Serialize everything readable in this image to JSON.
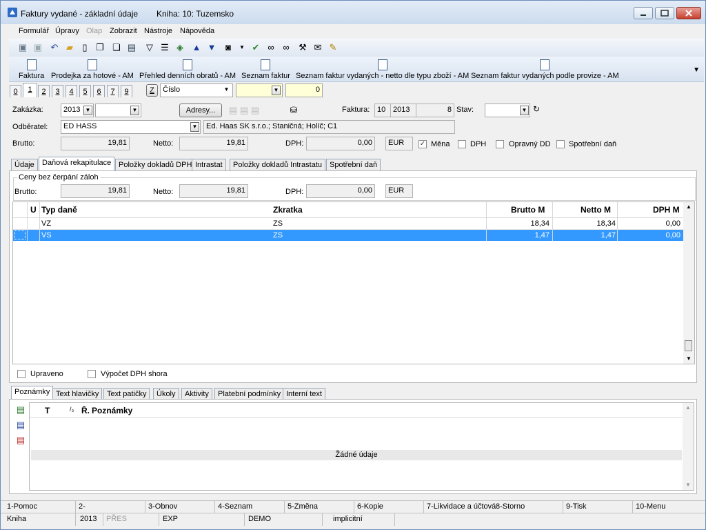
{
  "window": {
    "title": "Faktury vydané - základní údaje",
    "subtitle": "Kniha: 10: Tuzemsko"
  },
  "menu": {
    "items": [
      {
        "label": "Formulář",
        "disabled": false
      },
      {
        "label": "Úpravy",
        "disabled": false
      },
      {
        "label": "Olap",
        "disabled": true
      },
      {
        "label": "Zobrazit",
        "disabled": false
      },
      {
        "label": "Nástroje",
        "disabled": false
      },
      {
        "label": "Nápověda",
        "disabled": false
      }
    ]
  },
  "toolbar": {
    "icons": [
      "save-icon",
      "save-disabled-icon",
      "undo-icon",
      "open-folder-icon",
      "new-document-icon",
      "copy-icon",
      "paste-icon",
      "book-icon",
      "filter-icon",
      "filter-list-icon",
      "stack-icon",
      "arrow-up-icon",
      "arrow-down-icon",
      "camera-icon",
      "dropdown-icon",
      "run-icon",
      "binoculars-icon",
      "binoculars-next-icon",
      "tools-icon",
      "mail-icon",
      "notes-icon"
    ]
  },
  "ribbon": {
    "buttons": [
      {
        "label": "Faktura"
      },
      {
        "label": "Prodejka za hotové - AM"
      },
      {
        "label": "Přehled denních obratů - AM"
      },
      {
        "label": "Seznam faktur"
      },
      {
        "label": "Seznam faktur vydaných - netto dle typu zboží - AM"
      },
      {
        "label": "Seznam faktur vydaných podle provize - AM"
      }
    ]
  },
  "pagetabs": {
    "labels": [
      "0",
      "1",
      "2",
      "3",
      "4",
      "5",
      "6",
      "7",
      "9"
    ],
    "active": "1"
  },
  "filter": {
    "z_label": "Z",
    "field": "Číslo",
    "value": "",
    "count": "0"
  },
  "form": {
    "zakazka_label": "Zakázka:",
    "zakazka_year": "2013",
    "zakazka_value": "",
    "adresy_label": "Adresy...",
    "faktura_label": "Faktura:",
    "faktura_book": "10",
    "faktura_year": "2013",
    "faktura_number": "8",
    "stav_label": "Stav:",
    "stav_value": "",
    "odberatel_label": "Odběratel:",
    "odberatel_value": "ED HASS",
    "odberatel_address": "Ed. Haas SK s.r.o.; Staničná; Holíč; C1",
    "brutto_label": "Brutto:",
    "brutto_value": "19,81",
    "netto_label": "Netto:",
    "netto_value": "19,81",
    "dph_label": "DPH:",
    "dph_value": "0,00",
    "currency": "EUR",
    "mena_label": "Měna",
    "mena_checked": true,
    "dph_check_label": "DPH",
    "opravny_label": "Opravný DD",
    "spotrebni_label": "Spotřební daň"
  },
  "maintabs": {
    "labels": [
      "Údaje",
      "Daňová rekapitulace",
      "Položky dokladů DPH",
      "Intrastat",
      "Položky dokladů Intrastatu",
      "Spotřební daň"
    ],
    "active": "Daňová rekapitulace"
  },
  "recap": {
    "group_label": "Ceny bez čerpání záloh",
    "brutto_label": "Brutto:",
    "brutto_value": "19,81",
    "netto_label": "Netto:",
    "netto_value": "19,81",
    "dph_label": "DPH:",
    "dph_value": "0,00",
    "currency": "EUR"
  },
  "grid": {
    "headers": [
      "U",
      "Typ daně",
      "Zkratka",
      "Brutto M",
      "Netto M",
      "DPH M"
    ],
    "rows": [
      {
        "typ": "VZ",
        "zkratka": "ZS",
        "brutto": "18,34",
        "netto": "18,34",
        "dph": "0,00",
        "selected": false
      },
      {
        "typ": "VS",
        "zkratka": "ZS",
        "brutto": "1,47",
        "netto": "1,47",
        "dph": "0,00",
        "selected": true
      }
    ],
    "selection_color": "#3399ff"
  },
  "options": {
    "upraveno_label": "Upraveno",
    "vypocet_label": "Výpočet DPH shora"
  },
  "bottomtabs": {
    "labels": [
      "Poznámky",
      "Text hlavičky",
      "Text patičky",
      "Úkoly",
      "Aktivity",
      "Platební podmínky",
      "Interní text"
    ],
    "active": "Poznámky"
  },
  "notes": {
    "col_t": "T",
    "col_sort": "/₃",
    "col_r": "Ř.",
    "col_title": "Poznámky",
    "empty": "Žádné údaje"
  },
  "fkeys": [
    "1-Pomoc",
    "2-",
    "3-Obnov",
    "4-Seznam",
    "5-Změna",
    "6-Kopie",
    "7-Likvidace a účtová",
    "8-Storno",
    "9-Tisk",
    "10-Menu"
  ],
  "status": {
    "kniha": "Kniha",
    "year": "2013",
    "mode": "PŘES",
    "exp": "EXP",
    "db": "DEMO",
    "profile": "implicitní"
  }
}
